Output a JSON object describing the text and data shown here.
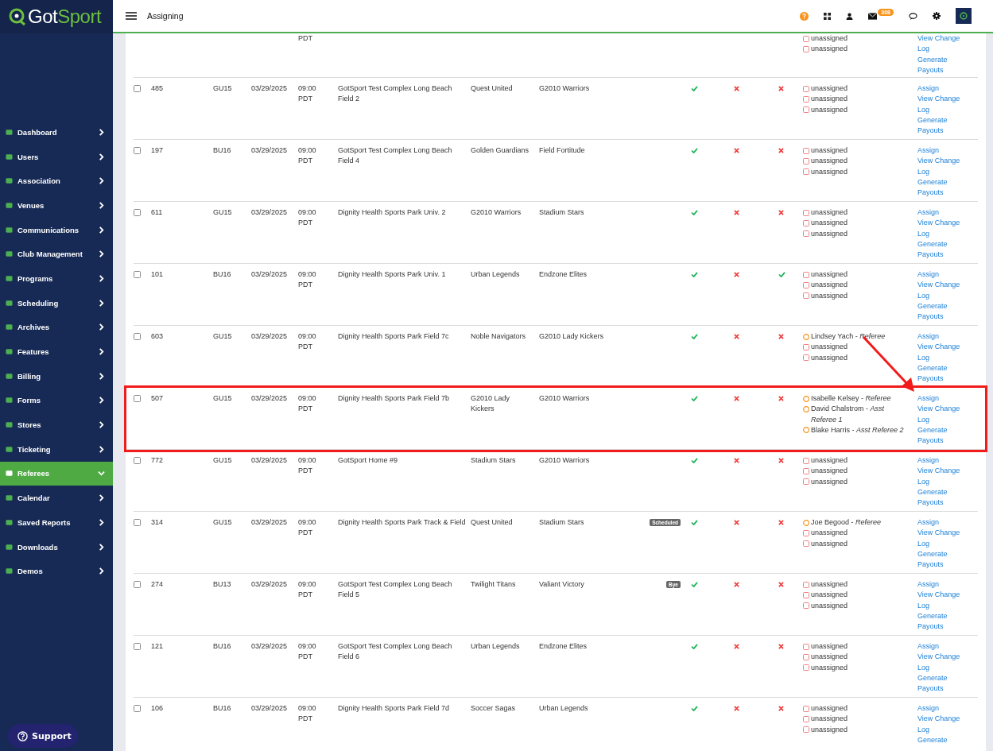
{
  "brand": {
    "primary": "Got",
    "accent": "Sport"
  },
  "header": {
    "title": "Assigning",
    "mail_count": "308"
  },
  "sidebar": {
    "items": [
      {
        "label": "Dashboard",
        "selected": false
      },
      {
        "label": "Users",
        "selected": false
      },
      {
        "label": "Association",
        "selected": false
      },
      {
        "label": "Venues",
        "selected": false
      },
      {
        "label": "Communications",
        "selected": false
      },
      {
        "label": "Club Management",
        "selected": false
      },
      {
        "label": "Programs",
        "selected": false
      },
      {
        "label": "Scheduling",
        "selected": false
      },
      {
        "label": "Archives",
        "selected": false
      },
      {
        "label": "Features",
        "selected": false
      },
      {
        "label": "Billing",
        "selected": false
      },
      {
        "label": "Forms",
        "selected": false
      },
      {
        "label": "Stores",
        "selected": false
      },
      {
        "label": "Ticketing",
        "selected": false
      },
      {
        "label": "Referees",
        "selected": true
      },
      {
        "label": "Calendar",
        "selected": false
      },
      {
        "label": "Saved Reports",
        "selected": false
      },
      {
        "label": "Downloads",
        "selected": false
      },
      {
        "label": "Demos",
        "selected": false
      }
    ],
    "support": "Support"
  },
  "partial_row": {
    "time": "PDT",
    "assignments": [
      {
        "kind": "unassigned",
        "text": "unassigned"
      },
      {
        "kind": "unassigned",
        "text": "unassigned"
      }
    ],
    "links": [
      "View Change Log",
      "Generate Payouts"
    ]
  },
  "rows": [
    {
      "id": "485",
      "age": "GU15",
      "date": "03/29/2025",
      "time": "09:00 PDT",
      "venue": "GotSport Test Complex Long Beach Field 2",
      "home": "Quest United",
      "away": "G2010 Warriors",
      "checks": [
        true,
        false,
        false
      ],
      "highlighted": false,
      "assignments": [
        {
          "kind": "unassigned",
          "text": "unassigned"
        },
        {
          "kind": "unassigned",
          "text": "unassigned"
        },
        {
          "kind": "unassigned",
          "text": "unassigned"
        }
      ],
      "links": [
        "Assign",
        "View Change Log",
        "Generate Payouts"
      ]
    },
    {
      "id": "197",
      "age": "BU16",
      "date": "03/29/2025",
      "time": "09:00 PDT",
      "venue": "GotSport Test Complex Long Beach Field 4",
      "home": "Golden Guardians",
      "away": "Field Fortitude",
      "checks": [
        true,
        false,
        false
      ],
      "highlighted": false,
      "assignments": [
        {
          "kind": "unassigned",
          "text": "unassigned"
        },
        {
          "kind": "unassigned",
          "text": "unassigned"
        },
        {
          "kind": "unassigned",
          "text": "unassigned"
        }
      ],
      "links": [
        "Assign",
        "View Change Log",
        "Generate Payouts"
      ]
    },
    {
      "id": "611",
      "age": "GU15",
      "date": "03/29/2025",
      "time": "09:00 PDT",
      "venue": "Dignity Health Sports Park Univ. 2",
      "home": "G2010 Warriors",
      "away": "Stadium Stars",
      "checks": [
        true,
        false,
        false
      ],
      "highlighted": false,
      "assignments": [
        {
          "kind": "unassigned",
          "text": "unassigned"
        },
        {
          "kind": "unassigned",
          "text": "unassigned"
        },
        {
          "kind": "unassigned",
          "text": "unassigned"
        }
      ],
      "links": [
        "Assign",
        "View Change Log",
        "Generate Payouts"
      ]
    },
    {
      "id": "101",
      "age": "BU16",
      "date": "03/29/2025",
      "time": "09:00 PDT",
      "venue": "Dignity Health Sports Park Univ. 1",
      "home": "Urban Legends",
      "away": "Endzone Elites",
      "checks": [
        true,
        false,
        true
      ],
      "highlighted": false,
      "assignments": [
        {
          "kind": "unassigned",
          "text": "unassigned"
        },
        {
          "kind": "unassigned",
          "text": "unassigned"
        },
        {
          "kind": "unassigned",
          "text": "unassigned"
        }
      ],
      "links": [
        "Assign",
        "View Change Log",
        "Generate Payouts"
      ]
    },
    {
      "id": "603",
      "age": "GU15",
      "date": "03/29/2025",
      "time": "09:00 PDT",
      "venue": "Dignity Health Sports Park Field 7c",
      "home": "Noble Navigators",
      "away": "G2010 Lady Kickers",
      "checks": [
        true,
        false,
        false
      ],
      "highlighted": false,
      "assignments": [
        {
          "kind": "assigned",
          "text": "Lindsey Yach - *Referee*"
        },
        {
          "kind": "unassigned",
          "text": "unassigned"
        },
        {
          "kind": "unassigned",
          "text": "unassigned"
        }
      ],
      "links": [
        "Assign",
        "View Change Log",
        "Generate Payouts"
      ]
    },
    {
      "id": "507",
      "age": "GU15",
      "date": "03/29/2025",
      "time": "09:00 PDT",
      "venue": "Dignity Health Sports Park Field 7b",
      "home": "G2010 Lady Kickers",
      "away": "G2010 Warriors",
      "checks": [
        true,
        false,
        false
      ],
      "highlighted": true,
      "assignments": [
        {
          "kind": "assigned",
          "text": "Isabelle Kelsey - *Referee*"
        },
        {
          "kind": "assigned",
          "text": "David Chalstrom - *Asst Referee 1*"
        },
        {
          "kind": "assigned",
          "text": "Blake Harris - *Asst Referee 2*"
        }
      ],
      "links": [
        "Assign",
        "View Change Log",
        "Generate Payouts"
      ]
    },
    {
      "id": "772",
      "age": "GU15",
      "date": "03/29/2025",
      "time": "09:00 PDT",
      "venue": "GotSport Home #9",
      "home": "Stadium Stars",
      "away": "G2010 Warriors",
      "checks": [
        true,
        false,
        false
      ],
      "highlighted": false,
      "assignments": [
        {
          "kind": "unassigned",
          "text": "unassigned"
        },
        {
          "kind": "unassigned",
          "text": "unassigned"
        },
        {
          "kind": "unassigned",
          "text": "unassigned"
        }
      ],
      "links": [
        "Assign",
        "View Change Log",
        "Generate Payouts"
      ]
    },
    {
      "id": "314",
      "age": "GU15",
      "date": "03/29/2025",
      "time": "09:00 PDT",
      "venue": "Dignity Health Sports Park Track & Field",
      "home": "Quest United",
      "away": "Stadium Stars",
      "badge": "Scheduled",
      "checks": [
        true,
        false,
        false
      ],
      "highlighted": false,
      "assignments": [
        {
          "kind": "assigned",
          "text": "Joe Begood - *Referee*"
        },
        {
          "kind": "unassigned",
          "text": "unassigned"
        },
        {
          "kind": "unassigned",
          "text": "unassigned"
        }
      ],
      "links": [
        "Assign",
        "View Change Log",
        "Generate Payouts"
      ]
    },
    {
      "id": "274",
      "age": "BU13",
      "date": "03/29/2025",
      "time": "09:00 PDT",
      "venue": "GotSport Test Complex Long Beach Field 5",
      "home": "Twilight Titans",
      "away": "Valiant Victory",
      "badge": "Bye",
      "checks": [
        true,
        false,
        false
      ],
      "highlighted": false,
      "assignments": [
        {
          "kind": "unassigned",
          "text": "unassigned"
        },
        {
          "kind": "unassigned",
          "text": "unassigned"
        },
        {
          "kind": "unassigned",
          "text": "unassigned"
        }
      ],
      "links": [
        "Assign",
        "View Change Log",
        "Generate Payouts"
      ]
    },
    {
      "id": "121",
      "age": "BU16",
      "date": "03/29/2025",
      "time": "09:00 PDT",
      "venue": "GotSport Test Complex Long Beach Field 6",
      "home": "Urban Legends",
      "away": "Endzone Elites",
      "checks": [
        true,
        false,
        false
      ],
      "highlighted": false,
      "assignments": [
        {
          "kind": "unassigned",
          "text": "unassigned"
        },
        {
          "kind": "unassigned",
          "text": "unassigned"
        },
        {
          "kind": "unassigned",
          "text": "unassigned"
        }
      ],
      "links": [
        "Assign",
        "View Change Log",
        "Generate Payouts"
      ]
    },
    {
      "id": "106",
      "age": "BU16",
      "date": "03/29/2025",
      "time": "09:00 PDT",
      "venue": "Dignity Health Sports Park Field 7d",
      "home": "Soccer Sagas",
      "away": "Urban Legends",
      "checks": [
        true,
        false,
        false
      ],
      "highlighted": false,
      "assignments": [
        {
          "kind": "unassigned",
          "text": "unassigned"
        },
        {
          "kind": "unassigned",
          "text": "unassigned"
        },
        {
          "kind": "unassigned",
          "text": "unassigned"
        }
      ],
      "links": [
        "Assign",
        "View Change Log",
        "Generate"
      ]
    }
  ]
}
